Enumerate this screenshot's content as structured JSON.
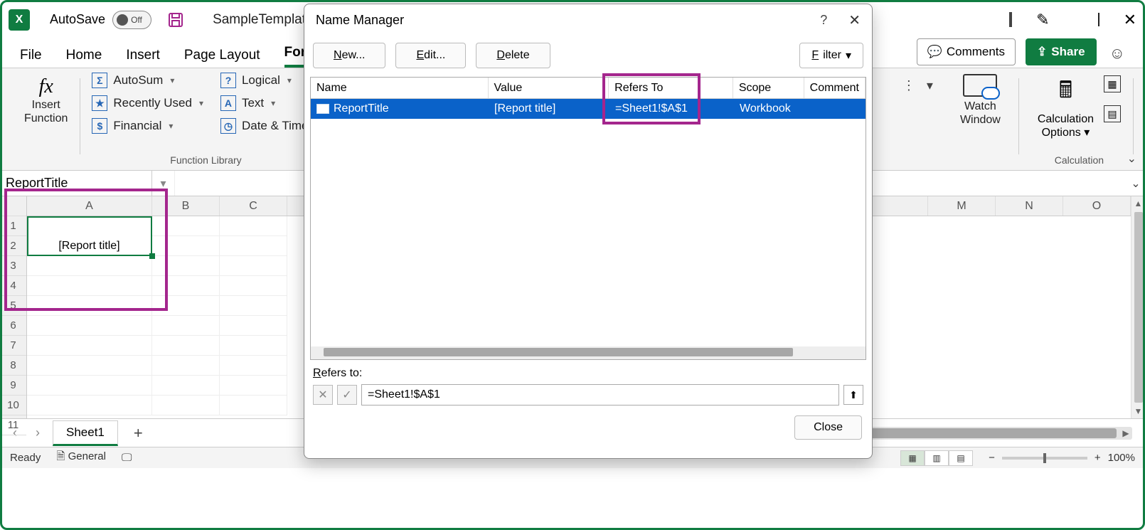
{
  "title_bar": {
    "autosave_label": "AutoSave",
    "autosave_state": "Off",
    "filename": "SampleTemplat"
  },
  "window_controls": {
    "minimize": "—",
    "maximize": "▢",
    "close": "✕"
  },
  "tabs": {
    "items": [
      "File",
      "Home",
      "Insert",
      "Page Layout",
      "Formulas"
    ],
    "active_index": 4,
    "comments": "Comments",
    "share": "Share"
  },
  "ribbon": {
    "insert_function": "Insert\nFunction",
    "function_library_label": "Function Library",
    "items_col1": [
      {
        "icon": "Σ",
        "label": "AutoSum"
      },
      {
        "icon": "★",
        "label": "Recently Used"
      },
      {
        "icon": "$",
        "label": "Financial"
      }
    ],
    "items_col2": [
      {
        "icon": "?",
        "label": "Logical"
      },
      {
        "icon": "A",
        "label": "Text"
      },
      {
        "icon": "◷",
        "label": "Date & Time"
      }
    ],
    "watch_window": "Watch\nWindow",
    "calc_options": "Calculation\nOptions",
    "calculation_label": "Calculation"
  },
  "formula_bar": {
    "name_box": "ReportTitle",
    "formula": ""
  },
  "grid": {
    "columns": [
      "A",
      "B",
      "C"
    ],
    "right_columns": [
      "M",
      "N",
      "O"
    ],
    "rows": [
      1,
      2,
      3,
      4,
      5,
      6,
      7,
      8,
      9,
      10,
      11
    ],
    "cellA1_2": "[Report title]"
  },
  "sheet_tabs": {
    "prev": "‹",
    "next": "›",
    "tab": "Sheet1",
    "add": "+"
  },
  "status_bar": {
    "ready": "Ready",
    "accessibility": "General",
    "zoom": "100%"
  },
  "dialog": {
    "title": "Name Manager",
    "new_btn": "New...",
    "edit_btn": "Edit...",
    "delete_btn": "Delete",
    "filter_btn": "Filter",
    "columns": [
      "Name",
      "Value",
      "Refers To",
      "Scope",
      "Comment"
    ],
    "rows": [
      {
        "name": "ReportTitle",
        "value": "[Report title]",
        "refers_to": "=Sheet1!$A$1",
        "scope": "Workbook",
        "comment": ""
      }
    ],
    "refers_to_label": "Refers to:",
    "refers_to_value": "=Sheet1!$A$1",
    "close_btn": "Close"
  }
}
